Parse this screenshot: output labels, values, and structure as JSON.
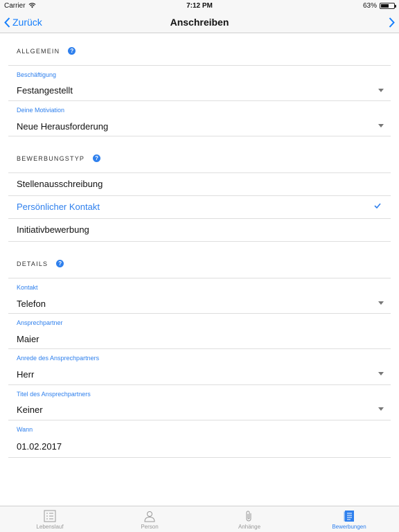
{
  "status": {
    "carrier": "Carrier",
    "time": "7:12 PM",
    "battery": "63%",
    "battery_level": 0.63
  },
  "nav": {
    "back_label": "Zurück",
    "title": "Anschreiben"
  },
  "sections": {
    "allgemein": "ALLGEMEIN",
    "bewerbungstyp": "BEWERBUNGSTYP",
    "details": "DETAILS",
    "help_glyph": "?"
  },
  "fields": {
    "beschaeftigung": {
      "label": "Beschäftigung",
      "value": "Festangestellt"
    },
    "motivation": {
      "label": "Deine Motiviation",
      "value": "Neue Herausforderung"
    },
    "kontakt": {
      "label": "Kontakt",
      "value": "Telefon"
    },
    "ansprechpartner": {
      "label": "Ansprechpartner",
      "value": "Maier"
    },
    "anrede": {
      "label": "Anrede des Ansprechpartners",
      "value": "Herr"
    },
    "titel": {
      "label": "Titel des Ansprechpartners",
      "value": "Keiner"
    },
    "wann": {
      "label": "Wann",
      "value": "01.02.2017"
    }
  },
  "options": [
    {
      "label": "Stellenausschreibung",
      "selected": false
    },
    {
      "label": "Persönlicher Kontakt",
      "selected": true
    },
    {
      "label": "Initiativbewerbung",
      "selected": false
    }
  ],
  "tabs": [
    {
      "label": "Lebenslauf",
      "icon": "list-icon",
      "active": false
    },
    {
      "label": "Person",
      "icon": "person-icon",
      "active": false
    },
    {
      "label": "Anhänge",
      "icon": "paperclip-icon",
      "active": false
    },
    {
      "label": "Bewerbungen",
      "icon": "document-icon",
      "active": true
    }
  ],
  "colors": {
    "accent": "#2f80ed",
    "ios_blue": "#157efb"
  }
}
